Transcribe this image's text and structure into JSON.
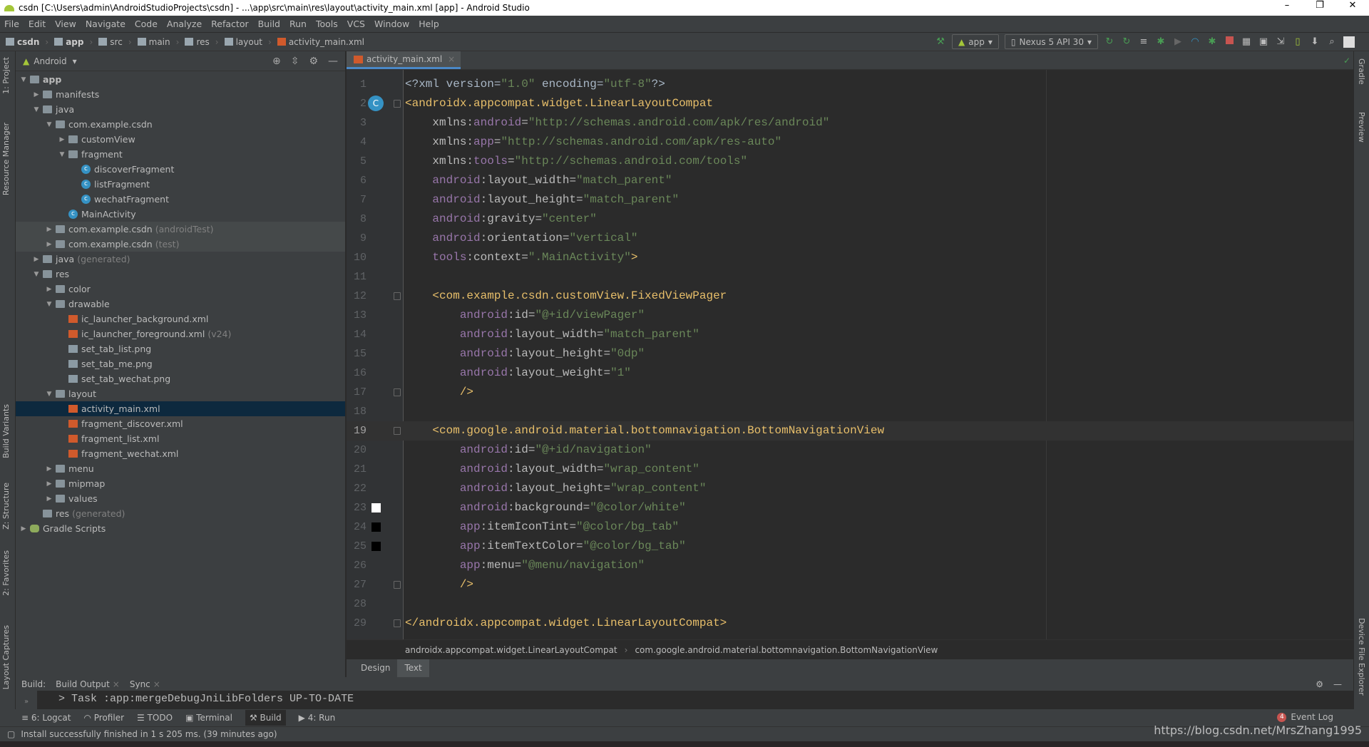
{
  "window": {
    "title": "csdn [C:\\Users\\admin\\AndroidStudioProjects\\csdn] - ...\\app\\src\\main\\res\\layout\\activity_main.xml [app] - Android Studio",
    "minimize": "–",
    "maximize": "❐",
    "close": "✕"
  },
  "menu": [
    "File",
    "Edit",
    "View",
    "Navigate",
    "Code",
    "Analyze",
    "Refactor",
    "Build",
    "Run",
    "Tools",
    "VCS",
    "Window",
    "Help"
  ],
  "breadcrumb": [
    "csdn",
    "app",
    "src",
    "main",
    "res",
    "layout",
    "activity_main.xml"
  ],
  "toolbar": {
    "run_config": "app",
    "device": "Nexus 5 API 30",
    "run_color": "#499c54",
    "stop_color": "#c75450"
  },
  "left_tabs": [
    "1: Project",
    "Resource Manager",
    "Build Variants",
    "Z: Structure",
    "2: Favorites",
    "Layout Captures"
  ],
  "right_tabs": [
    "Gradle",
    "Preview",
    "Device File Explorer"
  ],
  "project": {
    "view": "Android",
    "tree": [
      {
        "d": 0,
        "a": "▼",
        "i": "folder",
        "l": "app",
        "b": true
      },
      {
        "d": 1,
        "a": "▶",
        "i": "folder",
        "l": "manifests"
      },
      {
        "d": 1,
        "a": "▼",
        "i": "folder",
        "l": "java"
      },
      {
        "d": 2,
        "a": "▼",
        "i": "folder",
        "l": "com.example.csdn"
      },
      {
        "d": 3,
        "a": "▶",
        "i": "folder",
        "l": "customView"
      },
      {
        "d": 3,
        "a": "▼",
        "i": "folder",
        "l": "fragment"
      },
      {
        "d": 4,
        "a": "",
        "i": "cls",
        "l": "discoverFragment"
      },
      {
        "d": 4,
        "a": "",
        "i": "cls",
        "l": "listFragment"
      },
      {
        "d": 4,
        "a": "",
        "i": "cls",
        "l": "wechatFragment"
      },
      {
        "d": 3,
        "a": "",
        "i": "cls",
        "l": "MainActivity"
      },
      {
        "d": 2,
        "a": "▶",
        "i": "folder",
        "l": "com.example.csdn",
        "s": "(androidTest)",
        "h": true
      },
      {
        "d": 2,
        "a": "▶",
        "i": "folder",
        "l": "com.example.csdn",
        "s": "(test)",
        "h": true
      },
      {
        "d": 1,
        "a": "▶",
        "i": "folder",
        "l": "java",
        "s": "(generated)"
      },
      {
        "d": 1,
        "a": "▼",
        "i": "folder",
        "l": "res"
      },
      {
        "d": 2,
        "a": "▶",
        "i": "folder",
        "l": "color"
      },
      {
        "d": 2,
        "a": "▼",
        "i": "folder",
        "l": "drawable"
      },
      {
        "d": 3,
        "a": "",
        "i": "xml",
        "l": "ic_launcher_background.xml"
      },
      {
        "d": 3,
        "a": "",
        "i": "xml",
        "l": "ic_launcher_foreground.xml",
        "s": "(v24)"
      },
      {
        "d": 3,
        "a": "",
        "i": "png",
        "l": "set_tab_list.png"
      },
      {
        "d": 3,
        "a": "",
        "i": "png",
        "l": "set_tab_me.png"
      },
      {
        "d": 3,
        "a": "",
        "i": "png",
        "l": "set_tab_wechat.png"
      },
      {
        "d": 2,
        "a": "▼",
        "i": "folder",
        "l": "layout"
      },
      {
        "d": 3,
        "a": "",
        "i": "xml",
        "l": "activity_main.xml",
        "sel": true
      },
      {
        "d": 3,
        "a": "",
        "i": "xml",
        "l": "fragment_discover.xml"
      },
      {
        "d": 3,
        "a": "",
        "i": "xml",
        "l": "fragment_list.xml"
      },
      {
        "d": 3,
        "a": "",
        "i": "xml",
        "l": "fragment_wechat.xml"
      },
      {
        "d": 2,
        "a": "▶",
        "i": "folder",
        "l": "menu"
      },
      {
        "d": 2,
        "a": "▶",
        "i": "folder",
        "l": "mipmap"
      },
      {
        "d": 2,
        "a": "▶",
        "i": "folder",
        "l": "values"
      },
      {
        "d": 1,
        "a": "",
        "i": "folder",
        "l": "res",
        "s": "(generated)"
      },
      {
        "d": 0,
        "a": "▶",
        "i": "gradle",
        "l": "Gradle Scripts"
      }
    ]
  },
  "editor": {
    "tab": "activity_main.xml",
    "current_line": 19,
    "lines": [
      [
        [
          "pl",
          "<?xml version="
        ],
        [
          "val",
          "\"1.0\""
        ],
        [
          "pl",
          " encoding="
        ],
        [
          "val",
          "\"utf-8\""
        ],
        [
          "pl",
          "?>"
        ]
      ],
      [
        [
          "tag",
          "<androidx.appcompat.widget.LinearLayoutCompat"
        ]
      ],
      [
        [
          "at",
          "    xmlns:"
        ],
        [
          "ns",
          "android"
        ],
        [
          "at",
          "="
        ],
        [
          "val",
          "\"http://schemas.android.com/apk/res/android\""
        ]
      ],
      [
        [
          "at",
          "    xmlns:"
        ],
        [
          "ns",
          "app"
        ],
        [
          "at",
          "="
        ],
        [
          "val",
          "\"http://schemas.android.com/apk/res-auto\""
        ]
      ],
      [
        [
          "at",
          "    xmlns:"
        ],
        [
          "ns",
          "tools"
        ],
        [
          "at",
          "="
        ],
        [
          "val",
          "\"http://schemas.android.com/tools\""
        ]
      ],
      [
        [
          "ns",
          "    android"
        ],
        [
          "at",
          ":layout_width="
        ],
        [
          "val",
          "\"match_parent\""
        ]
      ],
      [
        [
          "ns",
          "    android"
        ],
        [
          "at",
          ":layout_height="
        ],
        [
          "val",
          "\"match_parent\""
        ]
      ],
      [
        [
          "ns",
          "    android"
        ],
        [
          "at",
          ":gravity="
        ],
        [
          "val",
          "\"center\""
        ]
      ],
      [
        [
          "ns",
          "    android"
        ],
        [
          "at",
          ":orientation="
        ],
        [
          "val",
          "\"vertical\""
        ]
      ],
      [
        [
          "ns",
          "    tools"
        ],
        [
          "at",
          ":context="
        ],
        [
          "val",
          "\".MainActivity\""
        ],
        [
          "tag",
          ">"
        ]
      ],
      [],
      [
        [
          "tag",
          "    <com.example.csdn.customView.FixedViewPager"
        ]
      ],
      [
        [
          "ns",
          "        android"
        ],
        [
          "at",
          ":id="
        ],
        [
          "val",
          "\"@+id/viewPager\""
        ]
      ],
      [
        [
          "ns",
          "        android"
        ],
        [
          "at",
          ":layout_width="
        ],
        [
          "val",
          "\"match_parent\""
        ]
      ],
      [
        [
          "ns",
          "        android"
        ],
        [
          "at",
          ":layout_height="
        ],
        [
          "val",
          "\"0dp\""
        ]
      ],
      [
        [
          "ns",
          "        android"
        ],
        [
          "at",
          ":layout_weight="
        ],
        [
          "val",
          "\"1\""
        ]
      ],
      [
        [
          "tag",
          "        />"
        ]
      ],
      [],
      [
        [
          "tag",
          "    <com.google.android.material.bottomnavigation.BottomNavigationView"
        ]
      ],
      [
        [
          "ns",
          "        android"
        ],
        [
          "at",
          ":id="
        ],
        [
          "val",
          "\"@+id/navigation\""
        ]
      ],
      [
        [
          "ns",
          "        android"
        ],
        [
          "at",
          ":layout_width="
        ],
        [
          "val",
          "\"wrap_content\""
        ]
      ],
      [
        [
          "ns",
          "        android"
        ],
        [
          "at",
          ":layout_height="
        ],
        [
          "val",
          "\"wrap_content\""
        ]
      ],
      [
        [
          "ns",
          "        android"
        ],
        [
          "at",
          ":background="
        ],
        [
          "val",
          "\"@color/white\""
        ]
      ],
      [
        [
          "ns",
          "        app"
        ],
        [
          "at",
          ":itemIconTint="
        ],
        [
          "val",
          "\"@color/bg_tab\""
        ]
      ],
      [
        [
          "ns",
          "        app"
        ],
        [
          "at",
          ":itemTextColor="
        ],
        [
          "val",
          "\"@color/bg_tab\""
        ]
      ],
      [
        [
          "ns",
          "        app"
        ],
        [
          "at",
          ":menu="
        ],
        [
          "val",
          "\"@menu/navigation\""
        ]
      ],
      [
        [
          "tag",
          "        />"
        ]
      ],
      [],
      [
        [
          "tag",
          "</androidx.appcompat.widget.LinearLayoutCompat>"
        ]
      ]
    ],
    "swatches": {
      "23": "#ffffff",
      "24": "#000000",
      "25": "#000000"
    },
    "folds": [
      2,
      12,
      17,
      19,
      27,
      29
    ],
    "gutter_icon_line": 2,
    "gutter_icon": "C",
    "breadcrumb": [
      "androidx.appcompat.widget.LinearLayoutCompat",
      "com.google.android.material.bottomnavigation.BottomNavigationView"
    ],
    "mode_tabs": [
      "Design",
      "Text"
    ],
    "active_mode": "Text"
  },
  "build": {
    "label": "Build:",
    "tabs": [
      "Build Output",
      "Sync"
    ],
    "output": "> Task :app:mergeDebugJniLibFolders UP-TO-DATE"
  },
  "bottom_tabs": [
    "6: Logcat",
    "Profiler",
    "TODO",
    "Terminal",
    "Build",
    "4: Run"
  ],
  "active_bottom_tab": "Build",
  "event_log": {
    "count": "4",
    "label": "Event Log"
  },
  "status": "Install successfully finished in 1 s 205 ms. (39 minutes ago)",
  "watermark": "https://blog.csdn.net/MrsZhang1995"
}
